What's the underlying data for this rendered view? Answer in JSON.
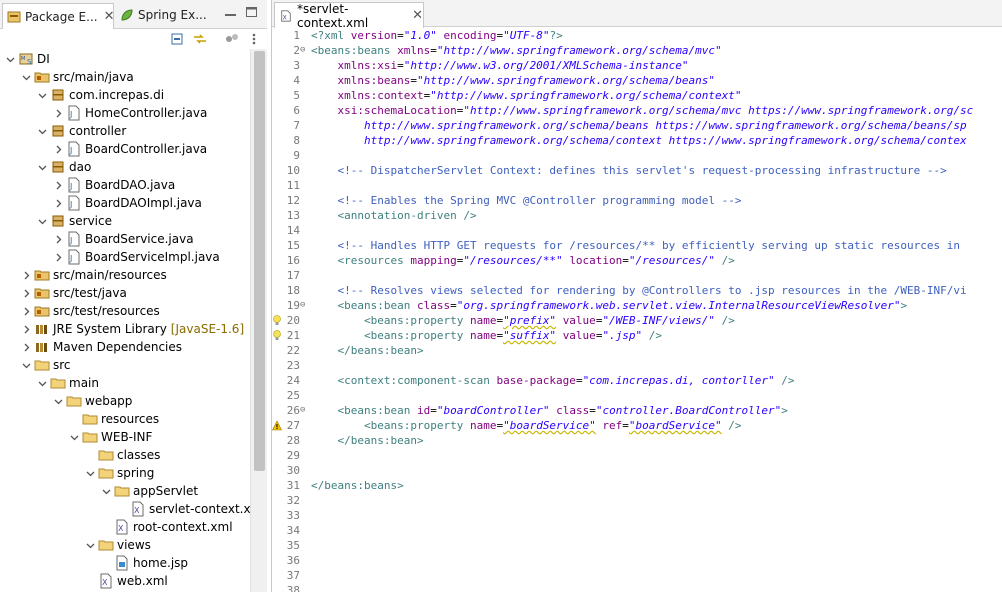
{
  "left_tabs": [
    {
      "label": "Package E...",
      "active": true
    },
    {
      "label": "Spring Ex...",
      "active": false
    }
  ],
  "tree": [
    {
      "label": "DI",
      "icon": "project-icon",
      "expanded": true
    },
    {
      "label": "src/main/java",
      "icon": "source-folder-icon",
      "expanded": true
    },
    {
      "label": "com.increpas.di",
      "icon": "package-icon",
      "expanded": true
    },
    {
      "label": "HomeController.java",
      "icon": "java-file-icon",
      "expanded": false
    },
    {
      "label": "controller",
      "icon": "package-icon",
      "expanded": true
    },
    {
      "label": "BoardController.java",
      "icon": "java-file-icon",
      "expanded": false
    },
    {
      "label": "dao",
      "icon": "package-icon",
      "expanded": true
    },
    {
      "label": "BoardDAO.java",
      "icon": "java-file-icon",
      "expanded": false
    },
    {
      "label": "BoardDAOImpl.java",
      "icon": "java-file-icon",
      "expanded": false
    },
    {
      "label": "service",
      "icon": "package-icon",
      "expanded": true
    },
    {
      "label": "BoardService.java",
      "icon": "java-file-icon",
      "expanded": false
    },
    {
      "label": "BoardServiceImpl.java",
      "icon": "java-file-icon",
      "expanded": false
    },
    {
      "label": "src/main/resources",
      "icon": "source-folder-icon",
      "expanded": false
    },
    {
      "label": "src/test/java",
      "icon": "source-folder-icon",
      "expanded": false
    },
    {
      "label": "src/test/resources",
      "icon": "source-folder-icon",
      "expanded": false
    },
    {
      "label": "JRE System Library",
      "icon": "library-icon",
      "expanded": false,
      "decoration": "[JavaSE-1.6]"
    },
    {
      "label": "Maven Dependencies",
      "icon": "library-icon",
      "expanded": false
    },
    {
      "label": "src",
      "icon": "folder-icon",
      "expanded": true
    },
    {
      "label": "main",
      "icon": "folder-icon",
      "expanded": true
    },
    {
      "label": "webapp",
      "icon": "folder-icon",
      "expanded": true
    },
    {
      "label": "resources",
      "icon": "folder-icon"
    },
    {
      "label": "WEB-INF",
      "icon": "folder-icon",
      "expanded": true
    },
    {
      "label": "classes",
      "icon": "folder-icon"
    },
    {
      "label": "spring",
      "icon": "folder-icon",
      "expanded": true
    },
    {
      "label": "appServlet",
      "icon": "folder-icon",
      "expanded": true
    },
    {
      "label": "servlet-context.xml",
      "icon": "xml-file-icon"
    },
    {
      "label": "root-context.xml",
      "icon": "xml-file-icon"
    },
    {
      "label": "views",
      "icon": "folder-icon",
      "expanded": true
    },
    {
      "label": "home.jsp",
      "icon": "jsp-file-icon"
    },
    {
      "label": "web.xml",
      "icon": "xml-file-icon"
    }
  ],
  "editor_tab": {
    "label": "*servlet-context.xml",
    "close": "✕"
  },
  "code_lines": [
    {
      "n": "1",
      "tokens": [
        [
          "pi",
          "<?xml "
        ],
        [
          "attr",
          "version"
        ],
        [
          "plain",
          "="
        ],
        [
          "val",
          "\"1.0\""
        ],
        [
          "plain",
          " "
        ],
        [
          "attr",
          "encoding"
        ],
        [
          "plain",
          "="
        ],
        [
          "val",
          "\"UTF-8\""
        ],
        [
          "pi",
          "?>"
        ]
      ]
    },
    {
      "n": "2",
      "fold": true,
      "tokens": [
        [
          "tag",
          "<beans:beans "
        ],
        [
          "attr",
          "xmlns"
        ],
        [
          "plain",
          "="
        ],
        [
          "val",
          "\"http://www.springframework.org/schema/mvc\""
        ]
      ]
    },
    {
      "n": "3",
      "tokens": [
        [
          "plain",
          "    "
        ],
        [
          "attr",
          "xmlns:xsi"
        ],
        [
          "plain",
          "="
        ],
        [
          "val",
          "\"http://www.w3.org/2001/XMLSchema-instance\""
        ]
      ]
    },
    {
      "n": "4",
      "tokens": [
        [
          "plain",
          "    "
        ],
        [
          "attr",
          "xmlns:beans"
        ],
        [
          "plain",
          "="
        ],
        [
          "val",
          "\"http://www.springframework.org/schema/beans\""
        ]
      ]
    },
    {
      "n": "5",
      "tokens": [
        [
          "plain",
          "    "
        ],
        [
          "attr",
          "xmlns:context"
        ],
        [
          "plain",
          "="
        ],
        [
          "val",
          "\"http://www.springframework.org/schema/context\""
        ]
      ]
    },
    {
      "n": "6",
      "tokens": [
        [
          "plain",
          "    "
        ],
        [
          "attr",
          "xsi:schemaLocation"
        ],
        [
          "plain",
          "="
        ],
        [
          "val",
          "\"http://www.springframework.org/schema/mvc https://www.springframework.org/sc"
        ]
      ]
    },
    {
      "n": "7",
      "tokens": [
        [
          "val",
          "        http://www.springframework.org/schema/beans https://www.springframework.org/schema/beans/sp"
        ]
      ]
    },
    {
      "n": "8",
      "tokens": [
        [
          "val",
          "        http://www.springframework.org/schema/context https://www.springframework.org/schema/contex"
        ]
      ]
    },
    {
      "n": "9",
      "tokens": []
    },
    {
      "n": "10",
      "tokens": [
        [
          "plain",
          "    "
        ],
        [
          "cmt",
          "<!-- DispatcherServlet Context: defines this servlet's request-processing infrastructure -->"
        ]
      ]
    },
    {
      "n": "11",
      "tokens": []
    },
    {
      "n": "12",
      "tokens": [
        [
          "plain",
          "    "
        ],
        [
          "cmt",
          "<!-- Enables the Spring MVC @Controller programming model -->"
        ]
      ]
    },
    {
      "n": "13",
      "tokens": [
        [
          "plain",
          "    "
        ],
        [
          "tag",
          "<annotation-driven />"
        ]
      ]
    },
    {
      "n": "14",
      "tokens": []
    },
    {
      "n": "15",
      "tokens": [
        [
          "plain",
          "    "
        ],
        [
          "cmt",
          "<!-- Handles HTTP GET requests for /resources/** by efficiently serving up static resources in"
        ]
      ]
    },
    {
      "n": "16",
      "tokens": [
        [
          "plain",
          "    "
        ],
        [
          "tag",
          "<resources "
        ],
        [
          "attr",
          "mapping"
        ],
        [
          "plain",
          "="
        ],
        [
          "val",
          "\"/resources/**\""
        ],
        [
          "plain",
          " "
        ],
        [
          "attr",
          "location"
        ],
        [
          "plain",
          "="
        ],
        [
          "val",
          "\"/resources/\""
        ],
        [
          "tag",
          " />"
        ]
      ]
    },
    {
      "n": "17",
      "tokens": []
    },
    {
      "n": "18",
      "tokens": [
        [
          "plain",
          "    "
        ],
        [
          "cmt",
          "<!-- Resolves views selected for rendering by @Controllers to .jsp resources in the /WEB-INF/vi"
        ]
      ]
    },
    {
      "n": "19",
      "fold": true,
      "tokens": [
        [
          "plain",
          "    "
        ],
        [
          "tag",
          "<beans:bean "
        ],
        [
          "attr",
          "class"
        ],
        [
          "plain",
          "="
        ],
        [
          "val",
          "\"org.springframework.web.servlet.view.InternalResourceViewResolver\""
        ],
        [
          "tag",
          ">"
        ]
      ]
    },
    {
      "n": "20",
      "marker": "bulb",
      "tokens": [
        [
          "plain",
          "        "
        ],
        [
          "tag",
          "<beans:property "
        ],
        [
          "attr",
          "name"
        ],
        [
          "plain",
          "="
        ],
        [
          "val",
          "\"prefix\"",
          "sq"
        ],
        [
          "plain",
          " "
        ],
        [
          "attr",
          "value"
        ],
        [
          "plain",
          "="
        ],
        [
          "val",
          "\"/WEB-INF/views/\""
        ],
        [
          "tag",
          " />"
        ]
      ]
    },
    {
      "n": "21",
      "marker": "bulb",
      "tokens": [
        [
          "plain",
          "        "
        ],
        [
          "tag",
          "<beans:property "
        ],
        [
          "attr",
          "name"
        ],
        [
          "plain",
          "="
        ],
        [
          "val",
          "\"suffix\"",
          "sq"
        ],
        [
          "plain",
          " "
        ],
        [
          "attr",
          "value"
        ],
        [
          "plain",
          "="
        ],
        [
          "val",
          "\".jsp\""
        ],
        [
          "tag",
          " />"
        ]
      ]
    },
    {
      "n": "22",
      "tokens": [
        [
          "plain",
          "    "
        ],
        [
          "tag",
          "</beans:bean>"
        ]
      ]
    },
    {
      "n": "23",
      "tokens": []
    },
    {
      "n": "24",
      "tokens": [
        [
          "plain",
          "    "
        ],
        [
          "tag",
          "<context:component-scan "
        ],
        [
          "attr",
          "base-package"
        ],
        [
          "plain",
          "="
        ],
        [
          "val",
          "\"com.increpas.di, contorller\""
        ],
        [
          "tag",
          " />"
        ]
      ]
    },
    {
      "n": "25",
      "tokens": []
    },
    {
      "n": "26",
      "fold": true,
      "tokens": [
        [
          "plain",
          "    "
        ],
        [
          "tag",
          "<beans:bean "
        ],
        [
          "attr",
          "id"
        ],
        [
          "plain",
          "="
        ],
        [
          "val",
          "\"boardController\""
        ],
        [
          "plain",
          " "
        ],
        [
          "attr",
          "class"
        ],
        [
          "plain",
          "="
        ],
        [
          "val",
          "\"controller.BoardController\""
        ],
        [
          "tag",
          ">"
        ]
      ]
    },
    {
      "n": "27",
      "marker": "warning",
      "tokens": [
        [
          "plain",
          "        "
        ],
        [
          "tag",
          "<beans:property "
        ],
        [
          "attr",
          "name"
        ],
        [
          "plain",
          "="
        ],
        [
          "val",
          "\"boardService\"",
          "sq"
        ],
        [
          "plain",
          " "
        ],
        [
          "attr",
          "ref"
        ],
        [
          "plain",
          "="
        ],
        [
          "val",
          "\"boardService\"",
          "sq"
        ],
        [
          "tag",
          " />"
        ]
      ]
    },
    {
      "n": "28",
      "tokens": [
        [
          "plain",
          "    "
        ],
        [
          "tag",
          "</beans:bean>"
        ]
      ]
    },
    {
      "n": "29",
      "tokens": []
    },
    {
      "n": "30",
      "tokens": []
    },
    {
      "n": "31",
      "tokens": [
        [
          "tag",
          "</beans:beans>"
        ]
      ]
    },
    {
      "n": "32",
      "tokens": []
    },
    {
      "n": "33",
      "tokens": []
    },
    {
      "n": "34",
      "tokens": []
    },
    {
      "n": "35",
      "tokens": []
    },
    {
      "n": "36",
      "tokens": []
    },
    {
      "n": "37",
      "tokens": []
    },
    {
      "n": "38",
      "tokens": []
    }
  ]
}
